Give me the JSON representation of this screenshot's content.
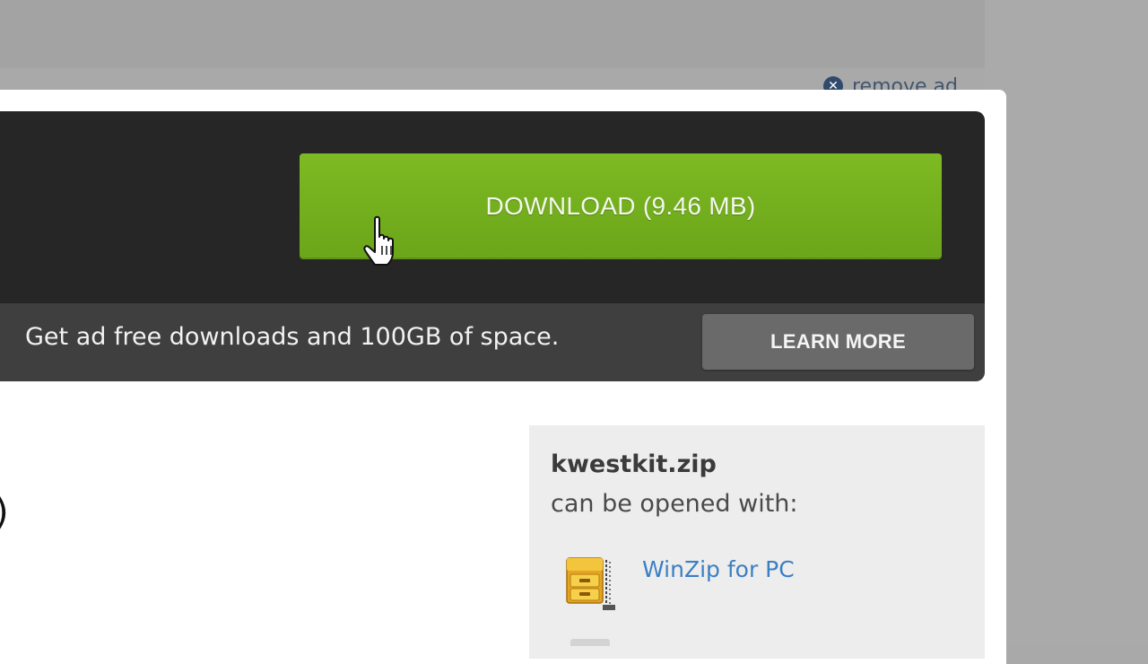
{
  "remove_ad": {
    "label": "remove ad",
    "icon": "close-circle-icon"
  },
  "download": {
    "label": "DOWNLOAD (9.46 MB)",
    "button_color": "#76b31e"
  },
  "cursor": {
    "icon": "hand-pointer-icon"
  },
  "promo": {
    "text": "Get ad free downloads and 100GB of space.",
    "learn_more_label": "LEARN MORE"
  },
  "left_fragment": {
    "text": ")"
  },
  "file_info": {
    "file_name": "kwestkit.zip",
    "open_with": "can be opened with:",
    "apps": [
      {
        "name": "WinZip for PC",
        "icon": "winzip-cabinet-icon"
      }
    ]
  },
  "colors": {
    "dark_panel": "#262626",
    "promo_bar": "#3f3f3f",
    "learn_more_bg": "#6a6a6a",
    "link": "#3b7fc4",
    "info_panel_bg": "#ededed"
  }
}
